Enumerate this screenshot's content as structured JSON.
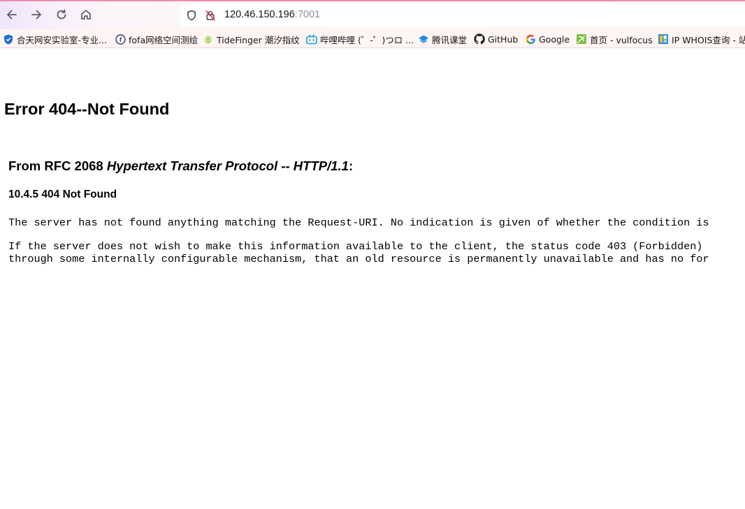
{
  "browser": {
    "url_host": "120.46.150.196",
    "url_port": ":7001"
  },
  "bookmarks": [
    {
      "label": "合天网安实验室-专业...",
      "icon": "shield-icon",
      "color": "#1f6fd8"
    },
    {
      "label": "fofa网络空间测绘",
      "icon": "fofa-icon",
      "color": "#2a3b8f"
    },
    {
      "label": "TideFinger 潮汐指纹",
      "icon": "tide-icon",
      "color": "#b9e07a"
    },
    {
      "label": "哔哩哔哩 (゜-゜)つロ ...",
      "icon": "bilibili-icon",
      "color": "#00a1d6"
    },
    {
      "label": "腾讯课堂",
      "icon": "tencent-classroom-icon",
      "color": "#1e88e5"
    },
    {
      "label": "GitHub",
      "icon": "github-icon",
      "color": "#1b1f23"
    },
    {
      "label": "Google",
      "icon": "google-icon",
      "color": "#4285f4"
    },
    {
      "label": "首页 - vulfocus",
      "icon": "vulfocus-icon",
      "color": "#7cc142"
    },
    {
      "label": "IP WHOIS查询 - 站",
      "icon": "whois-icon",
      "color": "#2f8fd0"
    }
  ],
  "page": {
    "title": "Error 404--Not Found",
    "rfc_prefix": "From RFC 2068 ",
    "rfc_title": "Hypertext Transfer Protocol -- HTTP/1.1",
    "rfc_suffix": ":",
    "section": "10.4.5 404 Not Found",
    "para1": "The server has not found anything matching the Request-URI. No indication is given of whether the condition is",
    "para2_line1": "If the server does not wish to make this information available to the client, the status code 403 (Forbidden)",
    "para2_line2": "through some internally configurable mechanism, that an old resource is permanently unavailable and has no for"
  }
}
